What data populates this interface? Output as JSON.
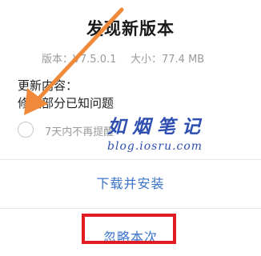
{
  "dialog": {
    "title": "发现新版本",
    "version": "版本：V7.5.0.1",
    "size": "大小：77.4 MB",
    "changelog_heading": "更新内容：",
    "changelog_item": "修复部分已知问题",
    "option_label": "7天内不再提醒",
    "install_button": "下载并安装",
    "ignore_button": "忽略本次"
  },
  "watermark": {
    "main": "如烟笔记",
    "sub": "blog.iosru.com"
  },
  "colors": {
    "accent": "#3b73c9",
    "annotation_arrow": "#f08a3a",
    "highlight_box": "#e01b24",
    "watermark": "#2f4fb0"
  }
}
